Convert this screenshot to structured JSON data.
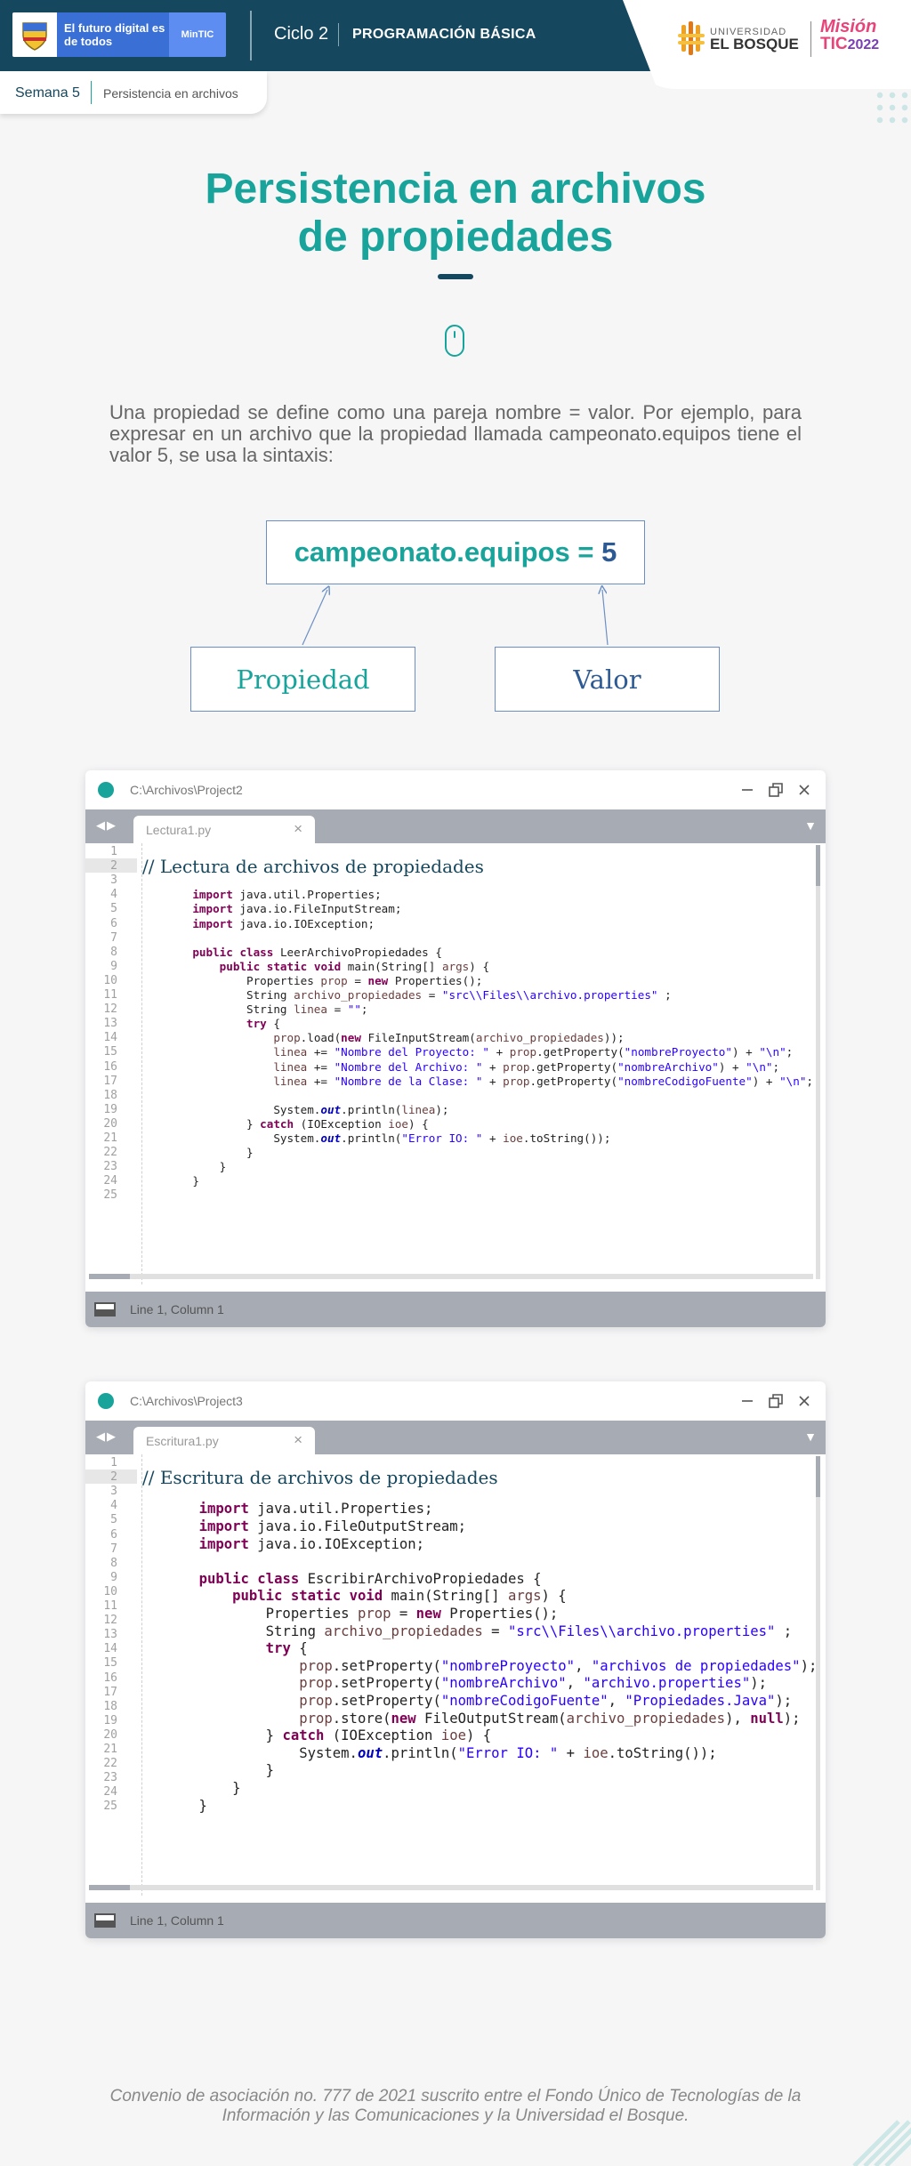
{
  "header": {
    "gov_slogan": "El futuro digital es de todos",
    "mintic": "MinTIC",
    "cycle": "Ciclo 2",
    "course": "PROGRAMACIÓN BÁSICA",
    "university_small": "UNIVERSIDAD",
    "university_name": "EL BOSQUE",
    "mision_1": "Misión",
    "mision_2": "TIC",
    "mision_year": "2022"
  },
  "breadcrumb": {
    "week": "Semana 5",
    "topic": "Persistencia en archivos"
  },
  "title": {
    "line1": "Persistencia en archivos",
    "line2": "de propiedades"
  },
  "intro": "Una propiedad se define como una pareja nombre = valor. Por ejemplo, para expresar en un archivo que la propiedad llamada campeonato.equipos tiene el valor 5, se usa la sintaxis:",
  "diagram": {
    "key": "campeonato.equipos = ",
    "value": "5",
    "label_property": "Propiedad",
    "label_value": "Valor"
  },
  "editor1": {
    "path": "C:\\Archivos\\Project2",
    "tab": "Lectura1.py",
    "comment": "// Lectura de archivos de propiedades",
    "status": "Line 1, Column 1",
    "line_count": 25,
    "lines": [
      "",
      "",
      "",
      "    import java.util.Properties;",
      "    import java.io.FileInputStream;",
      "    import java.io.IOException;",
      "",
      "    public class LeerArchivoPropiedades {",
      "        public static void main(String[] args) {",
      "            Properties prop = new Properties();",
      "            String archivo_propiedades = \"src\\\\Files\\\\archivo.properties\" ;",
      "            String linea = \"\";",
      "            try {",
      "                prop.load(new FileInputStream(archivo_propiedades));",
      "                linea += \"Nombre del Proyecto: \" + prop.getProperty(\"nombreProyecto\") + \"\\n\";",
      "                linea += \"Nombre del Archivo: \" + prop.getProperty(\"nombreArchivo\") + \"\\n\";",
      "                linea += \"Nombre de la Clase: \" + prop.getProperty(\"nombreCodigoFuente\") + \"\\n\";",
      "",
      "                System.out.println(linea);",
      "            } catch (IOException ioe) {",
      "                System.out.println(\"Error IO: \" + ioe.toString());",
      "            }",
      "        }",
      "    }",
      ""
    ]
  },
  "editor2": {
    "path": "C:\\Archivos\\Project3",
    "tab": "Escritura1.py",
    "comment": "// Escritura de archivos de propiedades",
    "status": "Line 1, Column 1",
    "line_count": 25,
    "lines": [
      "",
      "",
      "",
      "    import java.util.Properties;",
      "    import java.io.FileOutputStream;",
      "    import java.io.IOException;",
      "",
      "    public class EscribirArchivoPropiedades {",
      "        public static void main(String[] args) {",
      "            Properties prop = new Properties();",
      "            String archivo_propiedades = \"src\\\\Files\\\\archivo.properties\" ;",
      "            try {",
      "                prop.setProperty(\"nombreProyecto\", \"archivos de propiedades\");",
      "                prop.setProperty(\"nombreArchivo\", \"archivo.properties\");",
      "                prop.setProperty(\"nombreCodigoFuente\", \"Propiedades.Java\");",
      "                prop.store(new FileOutputStream(archivo_propiedades), null);",
      "            } catch (IOException ioe) {",
      "                System.out.println(\"Error IO: \" + ioe.toString());",
      "            }",
      "        }",
      "    }",
      "",
      "",
      "",
      ""
    ]
  },
  "footer": "Convenio de asociación no. 777 de 2021 suscrito entre el Fondo Único de Tecnologías de la Información y las Comunicaciones y la Universidad el Bosque.",
  "colors": {
    "teal": "#18a39b",
    "navy": "#15475e",
    "value_blue": "#2e5a94",
    "keyword": "#7f0055",
    "string": "#2a00ff"
  },
  "icons": {
    "mouse": "mouse-scroll-icon",
    "minimize": "minimize-icon",
    "restore": "restore-icon",
    "close": "close-icon"
  }
}
